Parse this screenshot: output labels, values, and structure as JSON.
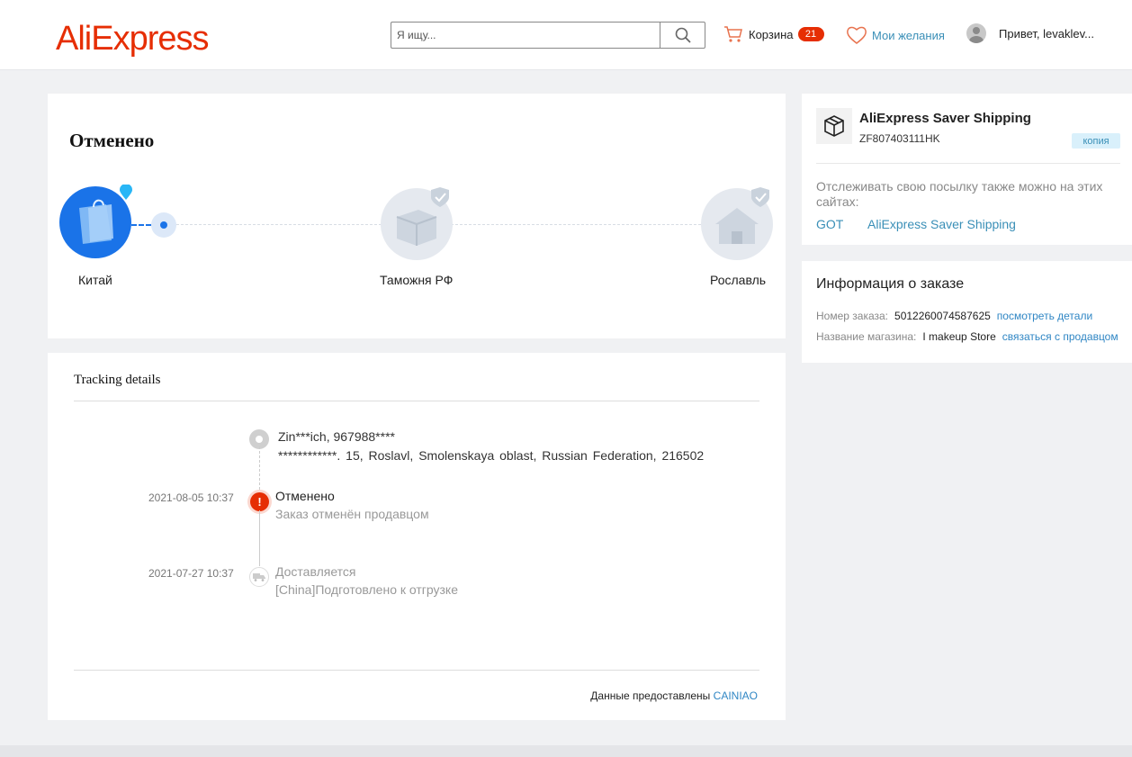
{
  "header": {
    "logo_text": "AliExpress",
    "search_placeholder": "Я ищу...",
    "cart_label": "Корзина",
    "cart_count": "21",
    "wishlist_label": "Мои желания",
    "user_greeting": "Привет, levaklev..."
  },
  "status": {
    "title": "Отменено",
    "nodes": [
      {
        "label": "Китай"
      },
      {
        "label": "Таможня РФ"
      },
      {
        "label": "Рославль"
      }
    ]
  },
  "tracking": {
    "title": "Tracking details",
    "address": {
      "name_phone": "Zin***ich,  967988****",
      "line": "************. 15,  Roslavl,  Smolenskaya oblast,  Russian Federation,  216502"
    },
    "events": [
      {
        "time": "2021-08-05 10:37",
        "title": "Отменено",
        "desc": "Заказ отменён продавцом"
      },
      {
        "time": "2021-07-27 10:37",
        "title": "Доставляется",
        "desc": "[China]Подготовлено к отгрузке"
      }
    ],
    "provided_by_label": "Данные предоставлены",
    "provider": "CAINIAO"
  },
  "shipping": {
    "service_name": "AliExpress Saver Shipping",
    "tracking_number": "ZF807403111HK",
    "copy_label": "копия",
    "note": "Отслеживать свою посылку также можно на этих сайтах:",
    "links": [
      "GOT",
      "AliExpress Saver Shipping"
    ]
  },
  "order": {
    "title": "Информация о заказе",
    "number_label": "Номер заказа:",
    "number": "5012260074587625",
    "details_link": "посмотреть детали",
    "store_label": "Название магазина:",
    "store": "I makeup Store",
    "contact_link": "связаться с продавцом"
  },
  "colors": {
    "brand": "#e62e04",
    "accent_blue": "#1a73e8",
    "link": "#3a8fb7"
  }
}
